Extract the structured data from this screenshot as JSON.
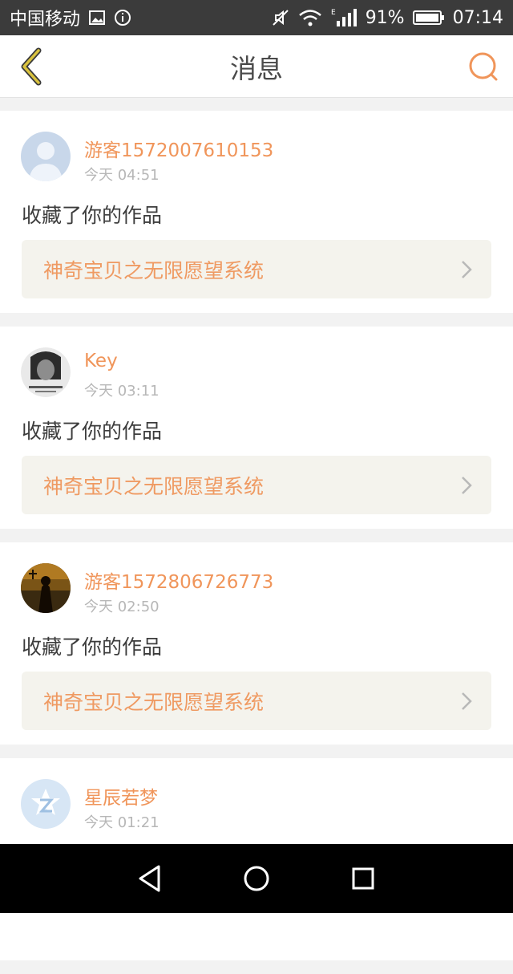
{
  "status_bar": {
    "carrier": "中国移动",
    "battery": "91%",
    "network_label": "E",
    "time": "07:14"
  },
  "header": {
    "title": "消息"
  },
  "messages": [
    {
      "username": "游客1572007610153",
      "time": "今天 04:51",
      "action": "收藏了你的作品",
      "work_title": "神奇宝贝之无限愿望系统",
      "avatar": "default-person-avatar"
    },
    {
      "username": "Key",
      "time": "今天 03:11",
      "action": "收藏了你的作品",
      "work_title": "神奇宝贝之无限愿望系统",
      "avatar": "photo-avatar"
    },
    {
      "username": "游客1572806726773",
      "time": "今天 02:50",
      "action": "收藏了你的作品",
      "work_title": "神奇宝贝之无限愿望系统",
      "avatar": "silhouette-avatar"
    },
    {
      "username": "星辰若梦",
      "time": "今天 01:21",
      "action": "",
      "work_title": "",
      "avatar": "qzone-avatar"
    }
  ],
  "colors": {
    "accent": "#f0955a",
    "back_icon": "#c9b13a",
    "card_bg": "#f4f3ed"
  }
}
